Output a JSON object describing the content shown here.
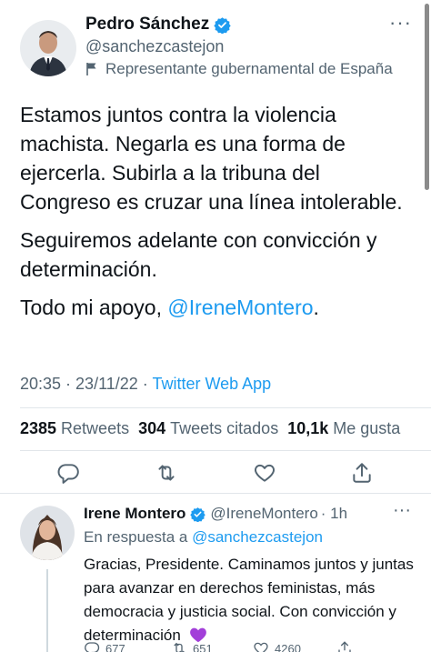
{
  "main_tweet": {
    "author_name": "Pedro Sánchez",
    "handle": "@sanchezcastejon",
    "gov_label": "Representante gubernamental de España",
    "more_label": "···",
    "paragraphs": [
      "Estamos juntos contra la violencia machista. Negarla es una forma de ejercerla. Subirla a la tribuna del Congreso es cruzar una línea intolerable.",
      "Seguiremos adelante con convicción y determinación."
    ],
    "p3_prefix": "Todo mi apoyo, ",
    "p3_mention": "@IreneMontero",
    "p3_suffix": ".",
    "time": "20:35",
    "date": "23/11/22",
    "dot": " · ",
    "source": "Twitter Web App",
    "stats": {
      "retweets_count": "2385",
      "retweets_label": "Retweets",
      "quotes_count": "304",
      "quotes_label": "Tweets citados",
      "likes_count": "10,1k",
      "likes_label": "Me gusta"
    }
  },
  "reply_tweet": {
    "author_name": "Irene Montero",
    "handle": "@IreneMontero",
    "time_ago": "· 1h",
    "more_label": "···",
    "reply_prefix": "En respuesta a ",
    "reply_to_mention": "@sanchezcastejon",
    "text": "Gracias, Presidente. Caminamos juntos y juntas para avanzar en derechos feministas, más democracia y justicia social. Con convicción y determinación",
    "counts": {
      "replies": "677",
      "retweets": "651",
      "likes": "4260"
    }
  },
  "colors": {
    "accent": "#1d9bf0",
    "secondary_text": "#536471",
    "verified": "#1d9bf0",
    "purple_heart": "#a23fd9"
  },
  "icons": [
    "verified-badge-icon",
    "flag-icon",
    "reply-icon",
    "retweet-icon",
    "like-icon",
    "share-icon",
    "purple-heart-emoji"
  ]
}
